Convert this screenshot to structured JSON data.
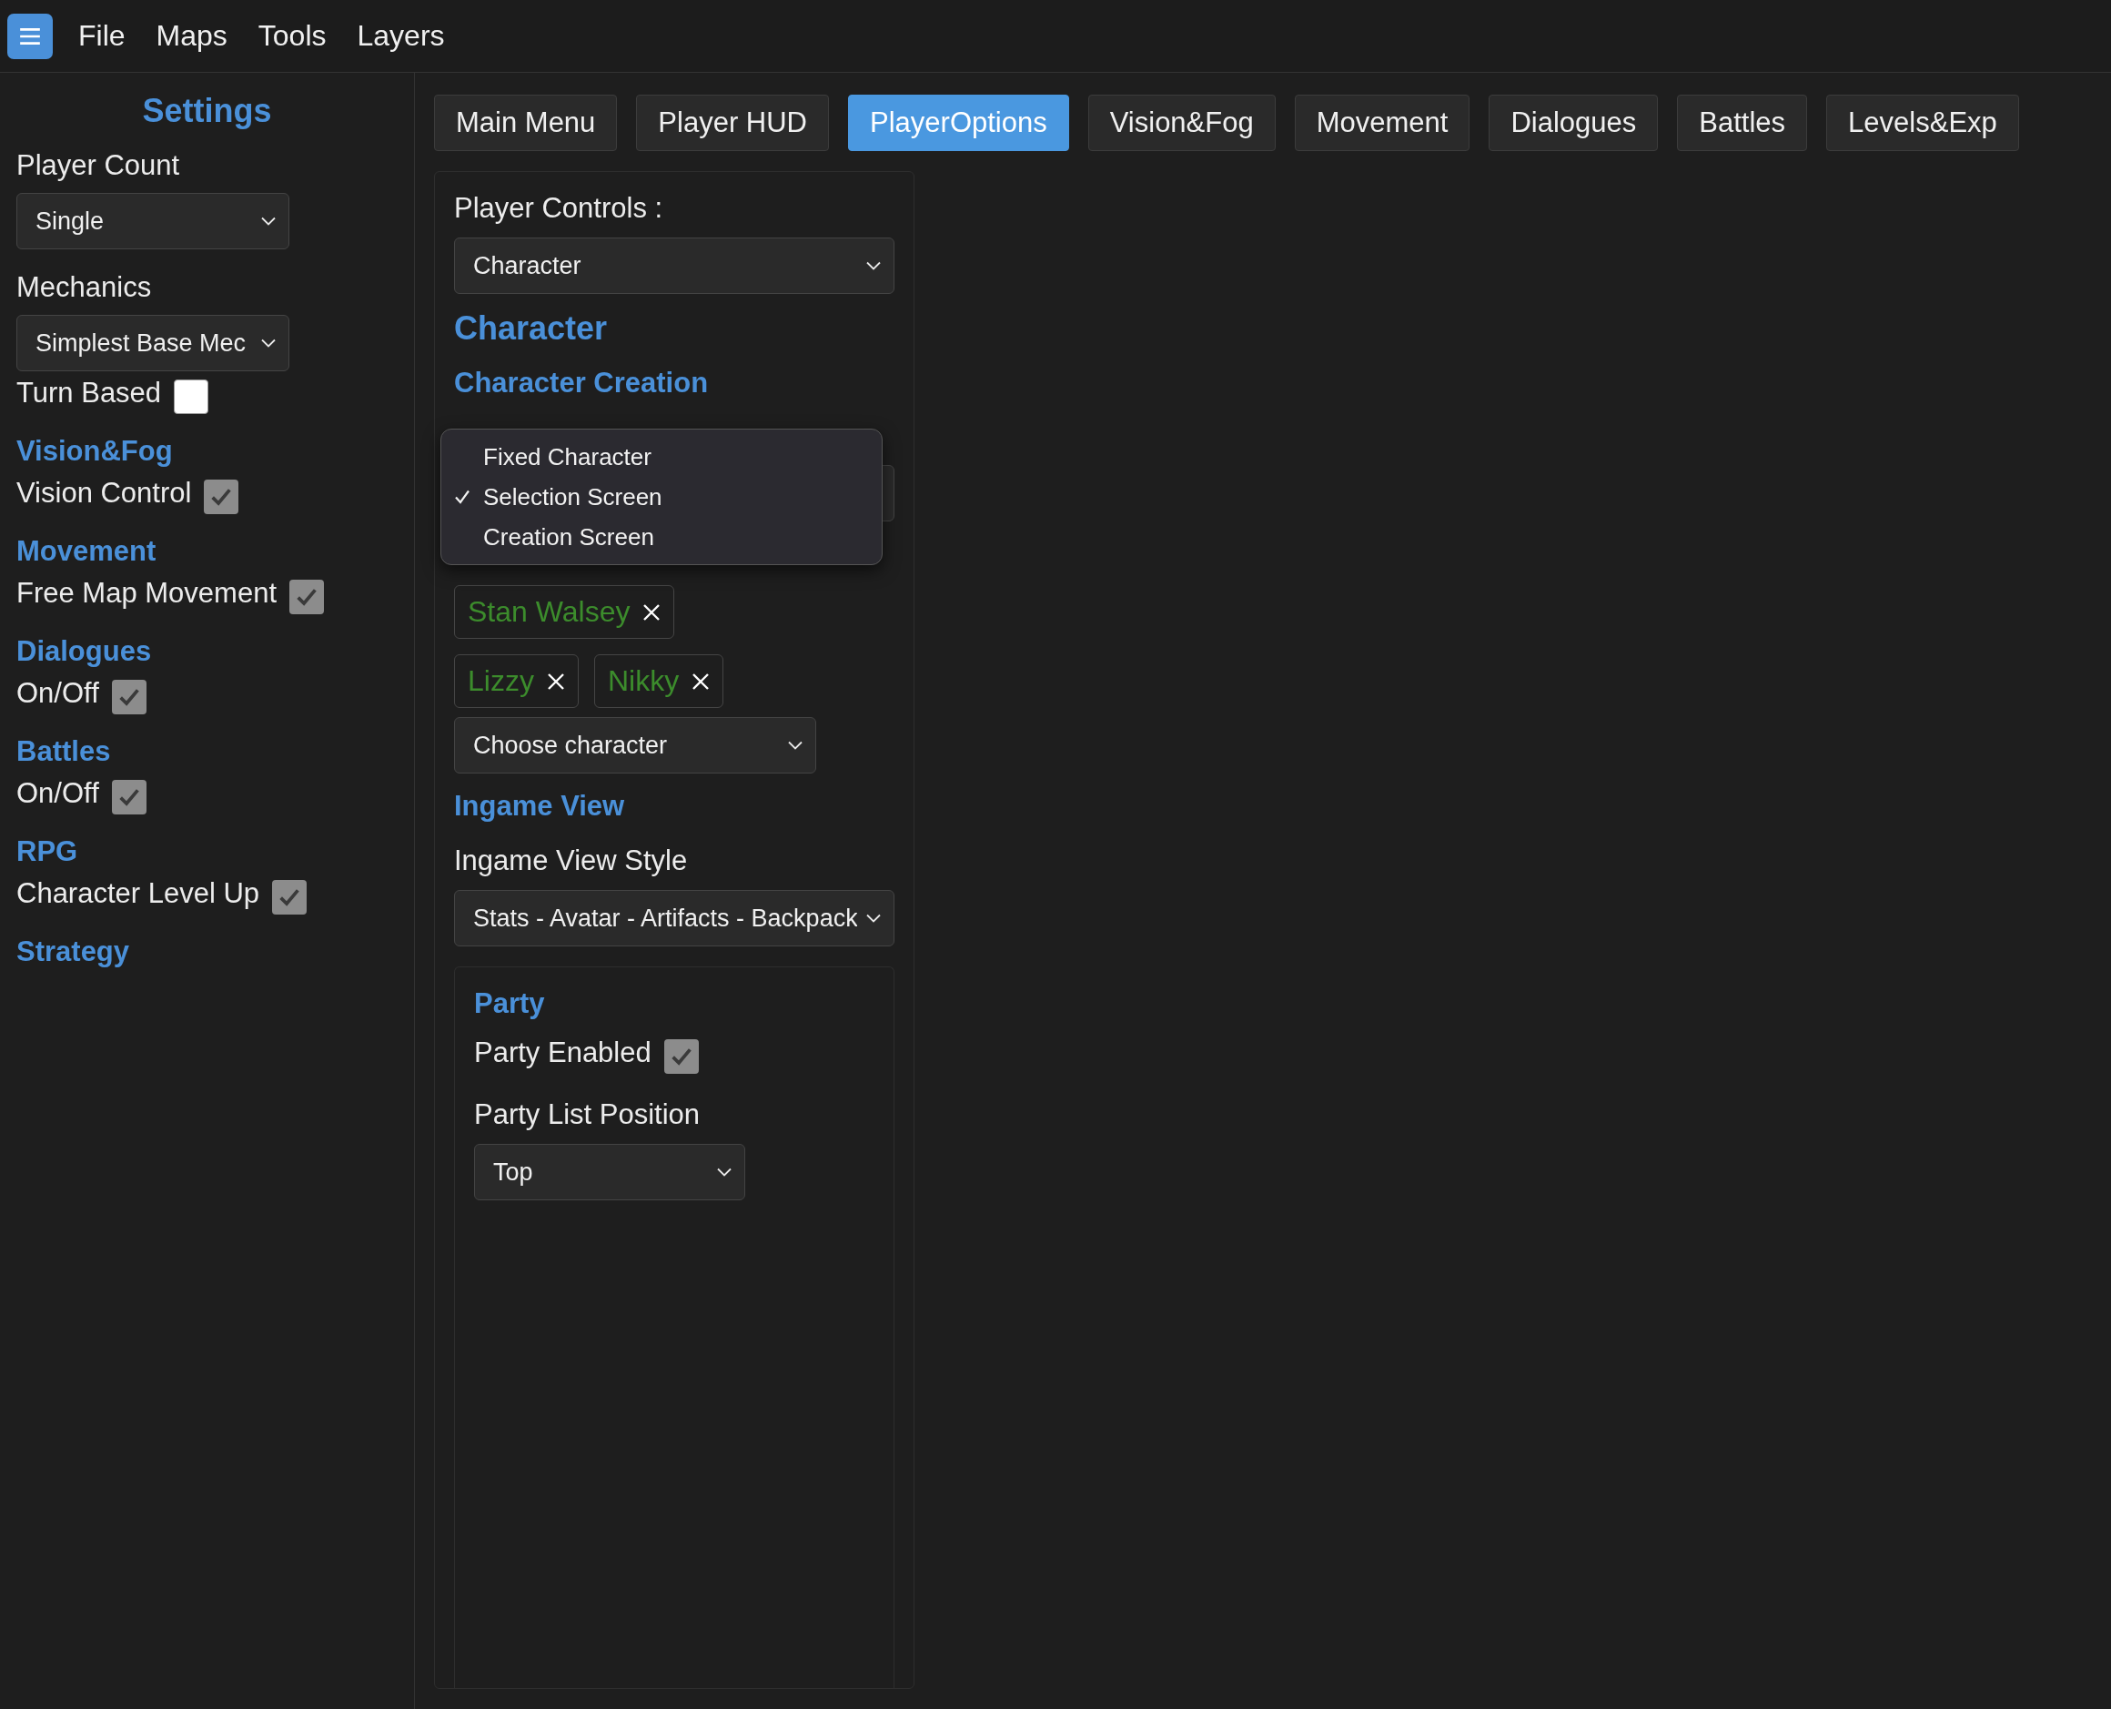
{
  "menu_bar": {
    "items": [
      "File",
      "Maps",
      "Tools",
      "Layers"
    ]
  },
  "sidebar": {
    "title": "Settings",
    "items": [
      {
        "kind": "label",
        "text": "Player Count"
      },
      {
        "kind": "select",
        "value": "Single"
      },
      {
        "kind": "label",
        "text": "Mechanics"
      },
      {
        "kind": "select",
        "value": "Simplest Base Mec"
      },
      {
        "kind": "checkbox",
        "label": "Turn Based",
        "checked": false
      },
      {
        "kind": "heading",
        "text": "Vision&Fog"
      },
      {
        "kind": "checkbox",
        "label": "Vision Control",
        "checked": true
      },
      {
        "kind": "heading",
        "text": "Movement"
      },
      {
        "kind": "checkbox",
        "label": "Free Map Movement",
        "checked": true
      },
      {
        "kind": "heading",
        "text": "Dialogues"
      },
      {
        "kind": "checkbox",
        "label": "On/Off",
        "checked": true
      },
      {
        "kind": "heading",
        "text": "Battles"
      },
      {
        "kind": "checkbox",
        "label": "On/Off",
        "checked": true
      },
      {
        "kind": "heading",
        "text": "RPG"
      },
      {
        "kind": "checkbox",
        "label": "Character Level Up",
        "checked": true
      },
      {
        "kind": "heading",
        "text": "Strategy"
      }
    ]
  },
  "tabs": [
    {
      "label": "Main Menu",
      "selected": false
    },
    {
      "label": "Player HUD",
      "selected": false
    },
    {
      "label": "PlayerOptions",
      "selected": true
    },
    {
      "label": "Vision&Fog",
      "selected": false
    },
    {
      "label": "Movement",
      "selected": false
    },
    {
      "label": "Dialogues",
      "selected": false
    },
    {
      "label": "Battles",
      "selected": false
    },
    {
      "label": "Levels&Exp",
      "selected": false
    }
  ],
  "panel": {
    "items": [
      {
        "kind": "label",
        "text": "Player Controls :"
      },
      {
        "kind": "select",
        "value": "Character"
      },
      {
        "kind": "heading",
        "text": "Character"
      },
      {
        "kind": "subheading",
        "text": "Character Creation"
      },
      {
        "kind": "covered-select"
      },
      {
        "kind": "tag-row",
        "tags": [
          "Stan Walsey"
        ]
      },
      {
        "kind": "tag-row",
        "tags": [
          "Lizzy",
          "Nikky"
        ]
      },
      {
        "kind": "select",
        "value": "Choose character"
      },
      {
        "kind": "subheading",
        "text": "Ingame View"
      },
      {
        "kind": "label",
        "text": "Ingame View Style"
      },
      {
        "kind": "select",
        "value": "Stats - Avatar - Artifacts - Backpack"
      },
      {
        "kind": "subpanel",
        "items": [
          {
            "kind": "subheading",
            "text": "Party"
          },
          {
            "kind": "checkbox",
            "label": "Party Enabled",
            "checked": true
          },
          {
            "kind": "label",
            "text": "Party List Position"
          },
          {
            "kind": "select",
            "value": "Top"
          }
        ]
      }
    ],
    "popup_menu": {
      "options": [
        {
          "label": "Fixed Character",
          "selected": false
        },
        {
          "label": "Selection Screen",
          "selected": true
        },
        {
          "label": "Creation Screen",
          "selected": false
        }
      ]
    }
  }
}
